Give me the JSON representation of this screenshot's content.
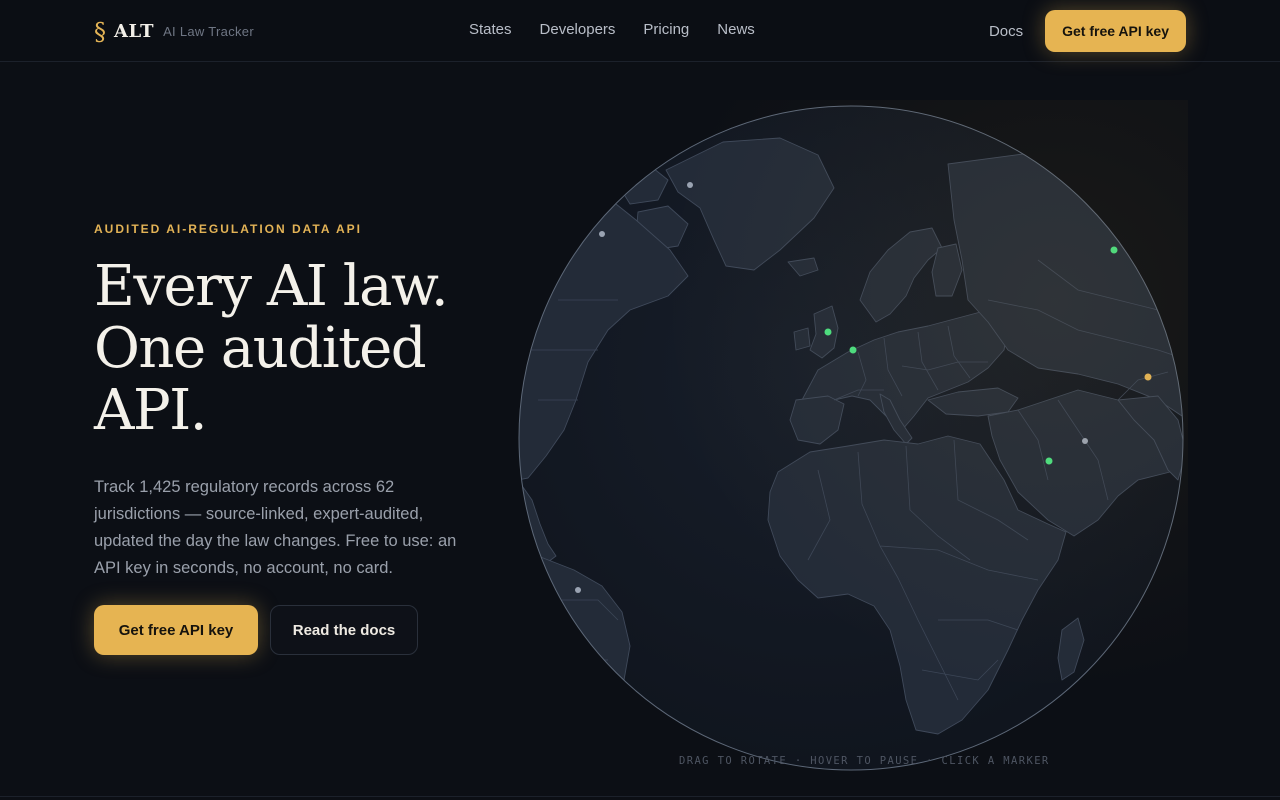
{
  "brand": {
    "mark": "§",
    "name": "ALT",
    "tagline": "AI Law Tracker"
  },
  "nav": {
    "links": [
      "States",
      "Developers",
      "Pricing",
      "News"
    ],
    "docs": "Docs",
    "cta": "Get free API key"
  },
  "hero": {
    "eyebrow": "AUDITED AI-REGULATION DATA API",
    "headline_1": "Every AI law.",
    "headline_2": "One audited",
    "headline_3": "API.",
    "lede": "Track 1,425 regulatory records across 62 jurisdictions — source-linked, expert-audited, updated the day the law changes. Free to use: an API key in seconds, no account, no card.",
    "primary_cta": "Get free API key",
    "secondary_cta": "Read the docs"
  },
  "globe": {
    "hint": "DRAG TO ROTATE · HOVER TO PAUSE · CLICK A MARKER",
    "colors": {
      "ocean": "#141a24",
      "land": "#232b38",
      "border": "#3f495a",
      "rim": "#5d6878",
      "green": "#4ade80",
      "amber": "#e3b356",
      "neutral": "#9aa3b2"
    }
  }
}
